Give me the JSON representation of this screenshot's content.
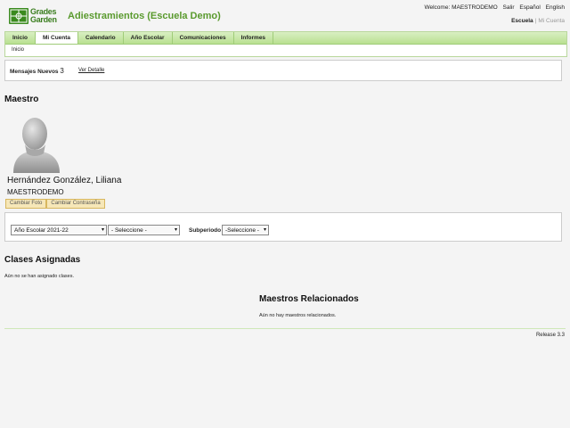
{
  "brand": {
    "logo_line1": "Grades",
    "logo_line2": "Garden",
    "app_title": "Adiestramientos (Escuela Demo)",
    "accent": "#5a9a2e"
  },
  "top_links": {
    "welcome": "Welcome: MAESTRODEMO",
    "salir": "Salir",
    "espanol": "Español",
    "english": "English"
  },
  "school_links": {
    "escuela": "Escuela",
    "separator": "|",
    "mi_cuenta": "Mi Cuenta"
  },
  "nav": {
    "tabs": [
      {
        "label": "Inicio"
      },
      {
        "label": "Mi Cuenta"
      },
      {
        "label": "Calendario"
      },
      {
        "label": "Año Escolar"
      },
      {
        "label": "Comunicaciones"
      },
      {
        "label": "Informes"
      }
    ],
    "active_tab": "Mi Cuenta",
    "subnav": "Inicio"
  },
  "messages": {
    "label": "Mensajes Nuevos",
    "count": "3",
    "link": "Ver Detalle"
  },
  "teacher": {
    "section_title": "Maestro",
    "name": "Hernández González, Liliana",
    "username": "MAESTRODEMO",
    "change_photo": "Cambiar Foto",
    "change_password": "Cambiar Contraseña",
    "avatar_icon": "person-silhouette-icon"
  },
  "filters": {
    "year": "Año Escolar 2021-22",
    "period": "- Seleccione -",
    "subperiod_label": "Subperiodo",
    "subperiod": "-Seleccione -"
  },
  "classes": {
    "title": "Clases Asignadas",
    "empty": "Aún no se han asignado clases."
  },
  "related": {
    "title": "Maestros Relacionados",
    "empty": "Aún no hay maestros relacionados."
  },
  "footer": {
    "release": "Release 3.3"
  }
}
